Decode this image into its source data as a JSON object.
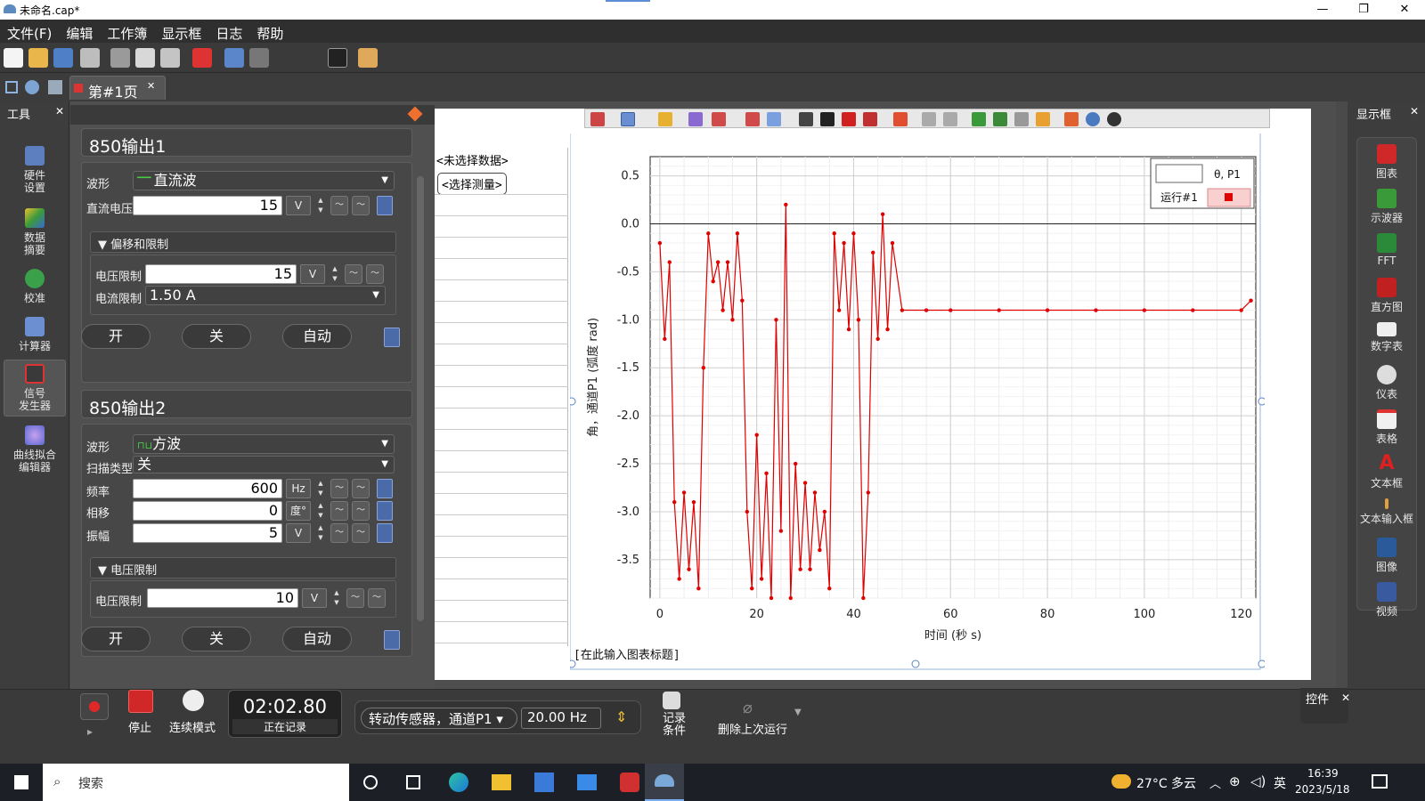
{
  "window": {
    "title": "未命名.cap*",
    "min": "—",
    "max": "❐",
    "close": "✕"
  },
  "menu": [
    "文件(F)",
    "编辑",
    "工作簿",
    "显示框",
    "日志",
    "帮助"
  ],
  "tab": {
    "label": "第#1页",
    "close": "✕"
  },
  "left_tools": {
    "header": "工具",
    "close": "✕",
    "items": [
      "硬件\n设置",
      "数据\n摘要",
      "校准",
      "计算器",
      "信号\n发生器",
      "曲线拟合\n编辑器"
    ]
  },
  "output1": {
    "title": "850输出1",
    "waveform_label": "波形",
    "waveform": "直流波",
    "dc_label": "直流电压",
    "dc_value": "15",
    "unit_v": "V",
    "sub": "偏移和限制",
    "vlimit_label": "电压限制",
    "vlimit": "15",
    "ilimit_label": "电流限制",
    "ilimit": "1.50 A",
    "on": "开",
    "off": "关",
    "auto": "自动"
  },
  "output2": {
    "title": "850输出2",
    "waveform_label": "波形",
    "waveform": "方波",
    "sweep_label": "扫描类型",
    "sweep": "关",
    "freq_label": "频率",
    "freq": "600",
    "freq_unit": "Hz",
    "phase_label": "相移",
    "phase": "0",
    "phase_unit": "度°",
    "amp_label": "振幅",
    "amp": "5",
    "amp_unit": "V",
    "sub": "电压限制",
    "vlimit_label": "电压限制",
    "vlimit": "10",
    "on": "开",
    "off": "关",
    "auto": "自动"
  },
  "table": {
    "no_data": "<未选择数据>",
    "select_btn": "<选择测量>"
  },
  "graph": {
    "legend_series": "θ, P1",
    "legend_run": "运行#1",
    "caption": "[在此输入图表标题]",
    "series_color": "#e00000"
  },
  "chart_data": {
    "type": "line",
    "xlabel": "时间 (秒 s)",
    "ylabel": "角，通道P1 (弧度 rad)",
    "xlim": [
      -2,
      123
    ],
    "ylim": [
      -3.9,
      0.7
    ],
    "xticks": [
      0,
      20,
      40,
      60,
      80,
      100,
      120
    ],
    "yticks": [
      0.5,
      0.0,
      -0.5,
      -1.0,
      -1.5,
      -2.0,
      -2.5,
      -3.0,
      -3.5
    ],
    "ytick_labels": [
      "0.5",
      "0.0",
      "-0.5",
      "-1.0",
      "-1.5",
      "-2.0",
      "-2.5",
      "-3.0",
      "-3.5"
    ],
    "series": [
      {
        "name": "θ, P1",
        "x": [
          0,
          1,
          2,
          3,
          4,
          5,
          6,
          7,
          8,
          9,
          10,
          11,
          12,
          13,
          14,
          15,
          16,
          17,
          18,
          19,
          20,
          21,
          22,
          23,
          24,
          25,
          26,
          27,
          28,
          29,
          30,
          31,
          32,
          33,
          34,
          35,
          36,
          37,
          38,
          39,
          40,
          41,
          42,
          43,
          44,
          45,
          46,
          47,
          48,
          50,
          55,
          60,
          70,
          80,
          90,
          100,
          110,
          120,
          122
        ],
        "y": [
          -0.2,
          -1.2,
          -0.4,
          -2.9,
          -3.7,
          -2.8,
          -3.6,
          -2.9,
          -3.8,
          -1.5,
          -0.1,
          -0.6,
          -0.4,
          -0.9,
          -0.4,
          -1.0,
          -0.1,
          -0.8,
          -3.0,
          -3.8,
          -2.2,
          -3.7,
          -2.6,
          -3.9,
          -1.0,
          -3.2,
          0.2,
          -3.9,
          -2.5,
          -3.6,
          -2.7,
          -3.6,
          -2.8,
          -3.4,
          -3.0,
          -3.8,
          -0.1,
          -0.9,
          -0.2,
          -1.1,
          -0.1,
          -1.0,
          -3.9,
          -2.8,
          -0.3,
          -1.2,
          0.1,
          -1.1,
          -0.2,
          -0.9,
          -0.9,
          -0.9,
          -0.9,
          -0.9,
          -0.9,
          -0.9,
          -0.9,
          -0.9,
          -0.8
        ]
      }
    ]
  },
  "right_tools": {
    "header": "显示框",
    "close": "✕",
    "items": [
      "图表",
      "示波器",
      "FFT",
      "直方图",
      "数字表",
      "仪表",
      "表格",
      "文本框",
      "文本输入框",
      "图像",
      "视频"
    ]
  },
  "bottom": {
    "stop": "停止",
    "mode": "连续模式",
    "time": "02:02.80",
    "recording": "正在记录",
    "sensor": "转动传感器，通道P1",
    "rate": "20.00 Hz",
    "cond": "记录\n条件",
    "delete": "删除上次运行",
    "controls": "控件",
    "controls_close": "✕"
  },
  "taskbar": {
    "search": "搜索",
    "weather": "27°C 多云",
    "lang": "英",
    "time": "16:39",
    "date": "2023/5/18"
  }
}
